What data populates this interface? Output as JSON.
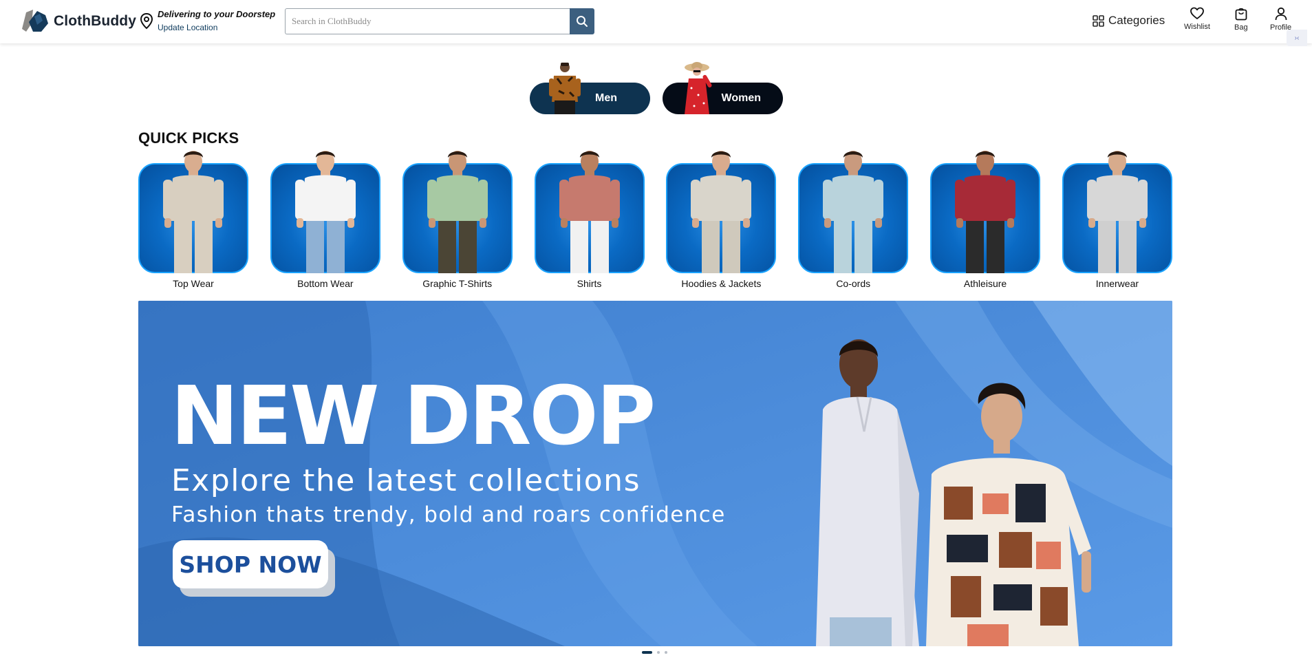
{
  "brand": {
    "name": "ClothBuddy"
  },
  "delivery": {
    "title": "Delivering to your Doorstep",
    "link": "Update Location"
  },
  "search": {
    "placeholder": "Search in ClothBuddy",
    "value": ""
  },
  "nav": {
    "categories": "Categories",
    "wishlist": "Wishlist",
    "bag": "Bag",
    "profile": "Profile"
  },
  "gender": {
    "men": "Men",
    "women": "Women"
  },
  "quick_picks": {
    "title": "QUICK PICKS",
    "items": [
      {
        "label": "Top Wear",
        "shirt": "#d8cfc0",
        "pants": "#d8cfc0"
      },
      {
        "label": "Bottom Wear",
        "shirt": "#f4f4f4",
        "pants": "#8fb1d4"
      },
      {
        "label": "Graphic T-Shirts",
        "shirt": "#a7c9a3",
        "pants": "#4b4535"
      },
      {
        "label": "Shirts",
        "shirt": "#c67a6e",
        "pants": "#f1f1f1"
      },
      {
        "label": "Hoodies & Jackets",
        "shirt": "#d9d5cb",
        "pants": "#cfc9bc"
      },
      {
        "label": "Co-ords",
        "shirt": "#b9d3dc",
        "pants": "#b9d3dc"
      },
      {
        "label": "Athleisure",
        "shirt": "#a72a37",
        "pants": "#2b2b2b"
      },
      {
        "label": "Innerwear",
        "shirt": "#d7d7d7",
        "pants": "#cfcfcf"
      }
    ]
  },
  "banner": {
    "headline": "NEW DROP",
    "subline1": "Explore the latest collections",
    "subline2": "Fashion thats trendy, bold and roars confidence",
    "cta": "SHOP NOW"
  },
  "carousel": {
    "slides": 3,
    "active_index": 0
  },
  "colors": {
    "brand_navy": "#0e3350",
    "search_button": "#3c5f7f",
    "quickpick_blue": "#0a6ac4",
    "banner_blue": "#4a8ad8",
    "cta_text": "#1c4f9c"
  }
}
